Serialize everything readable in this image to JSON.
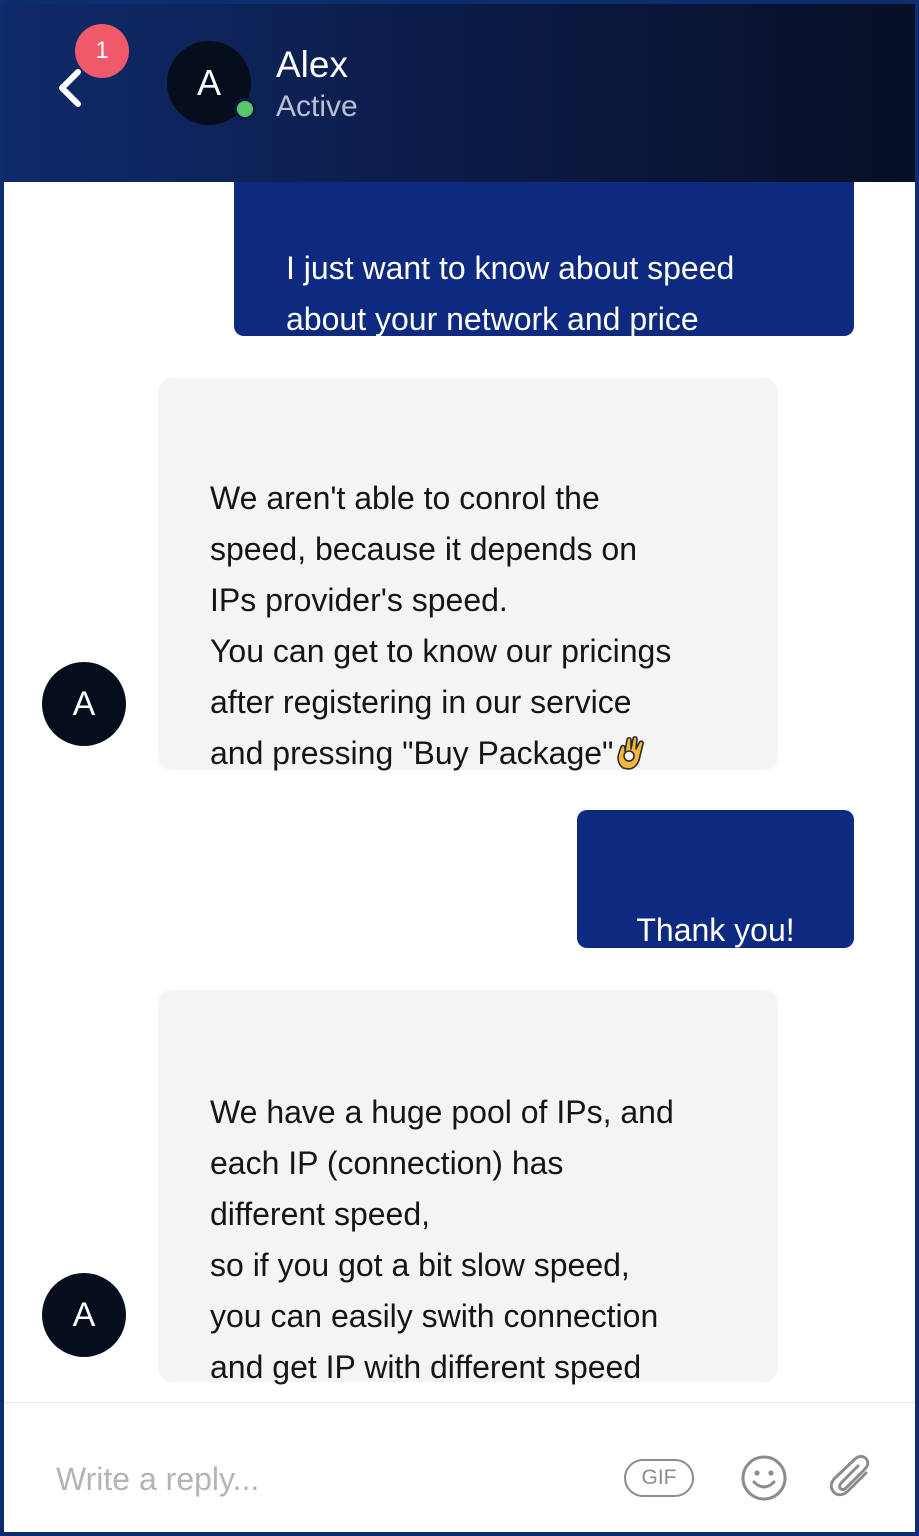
{
  "header": {
    "notification_count": "1",
    "avatar_initial": "A",
    "contact_name": "Alex",
    "contact_status": "Active"
  },
  "messages": [
    {
      "direction": "outgoing",
      "text": "I just want to know about speed\nabout your network and price"
    },
    {
      "direction": "incoming",
      "avatar_initial": "A",
      "text": "We aren't able to conrol the\nspeed, because it depends on\nIPs provider's speed.\nYou can get to know our pricings\nafter registering in our service\nand pressing \"Buy Package\"",
      "emoji": "ok-hand-emoji"
    },
    {
      "direction": "outgoing",
      "text": "Thank you!"
    },
    {
      "direction": "incoming",
      "avatar_initial": "A",
      "text": "We have a huge pool of IPs, and\neach IP (connection) has\ndifferent speed,\nso if you got a bit slow speed,\nyou can easily swith connection\nand get IP with different speed"
    }
  ],
  "composer": {
    "placeholder": "Write a reply...",
    "value": "",
    "gif_label": "GIF",
    "emoji_icon": "smiley-icon",
    "attach_icon": "paperclip-icon"
  },
  "colors": {
    "header_start": "#0f2a6a",
    "header_end": "#070f26",
    "outgoing_bubble": "#0d2a80",
    "incoming_bubble": "#f4f4f4",
    "badge": "#ef5a6a",
    "online": "#58c76a"
  }
}
